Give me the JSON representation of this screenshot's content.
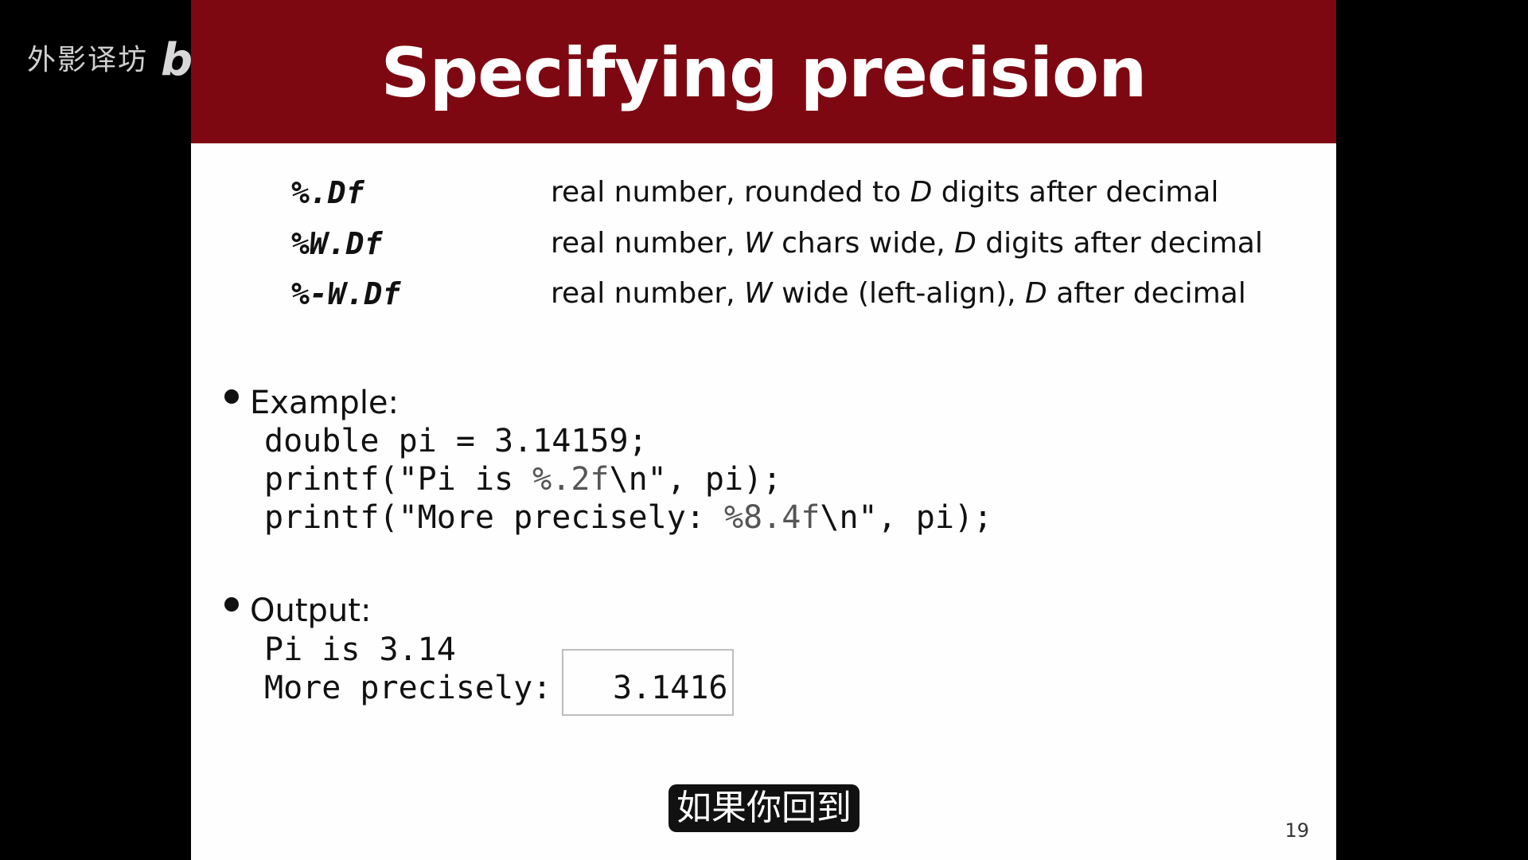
{
  "slide": {
    "title": "Specifying precision",
    "specs": [
      {
        "code": "%.Df",
        "desc_pre": "real number, rounded to ",
        "desc_var1": "D",
        "desc_mid": " digits after decimal",
        "desc_var2": "",
        "desc_post": ""
      },
      {
        "code": "%W.Df",
        "desc_pre": "real number, ",
        "desc_var1": "W",
        "desc_mid": " chars wide, ",
        "desc_var2": "D",
        "desc_post": " digits after decimal"
      },
      {
        "code": "%-W.Df",
        "desc_pre": "real number, ",
        "desc_var1": "W",
        "desc_mid": " wide (left-align), ",
        "desc_var2": "D",
        "desc_post": " after decimal"
      }
    ],
    "example": {
      "label": "Example:",
      "line1": "double pi = 3.14159;",
      "line2_pre": "printf(\"Pi is ",
      "line2_fmt": "%.2f",
      "line2_post": "\\n\", pi);",
      "line3_pre": "printf(\"More precisely: ",
      "line3_fmt": "%8.4f",
      "line3_post": "\\n\", pi);"
    },
    "output": {
      "label": "Output:",
      "line1": "Pi is 3.14",
      "line2_label": "More precisely:",
      "line2_value": "3.1416"
    },
    "slide_number": "19"
  },
  "video": {
    "subtitle": "如果你回到",
    "watermark_text": "外影译坊",
    "watermark_logo": "bilibili"
  },
  "colors": {
    "title_band": "#7e0812",
    "slide_bg": "#fefefe",
    "outer_bg": "#000000"
  }
}
